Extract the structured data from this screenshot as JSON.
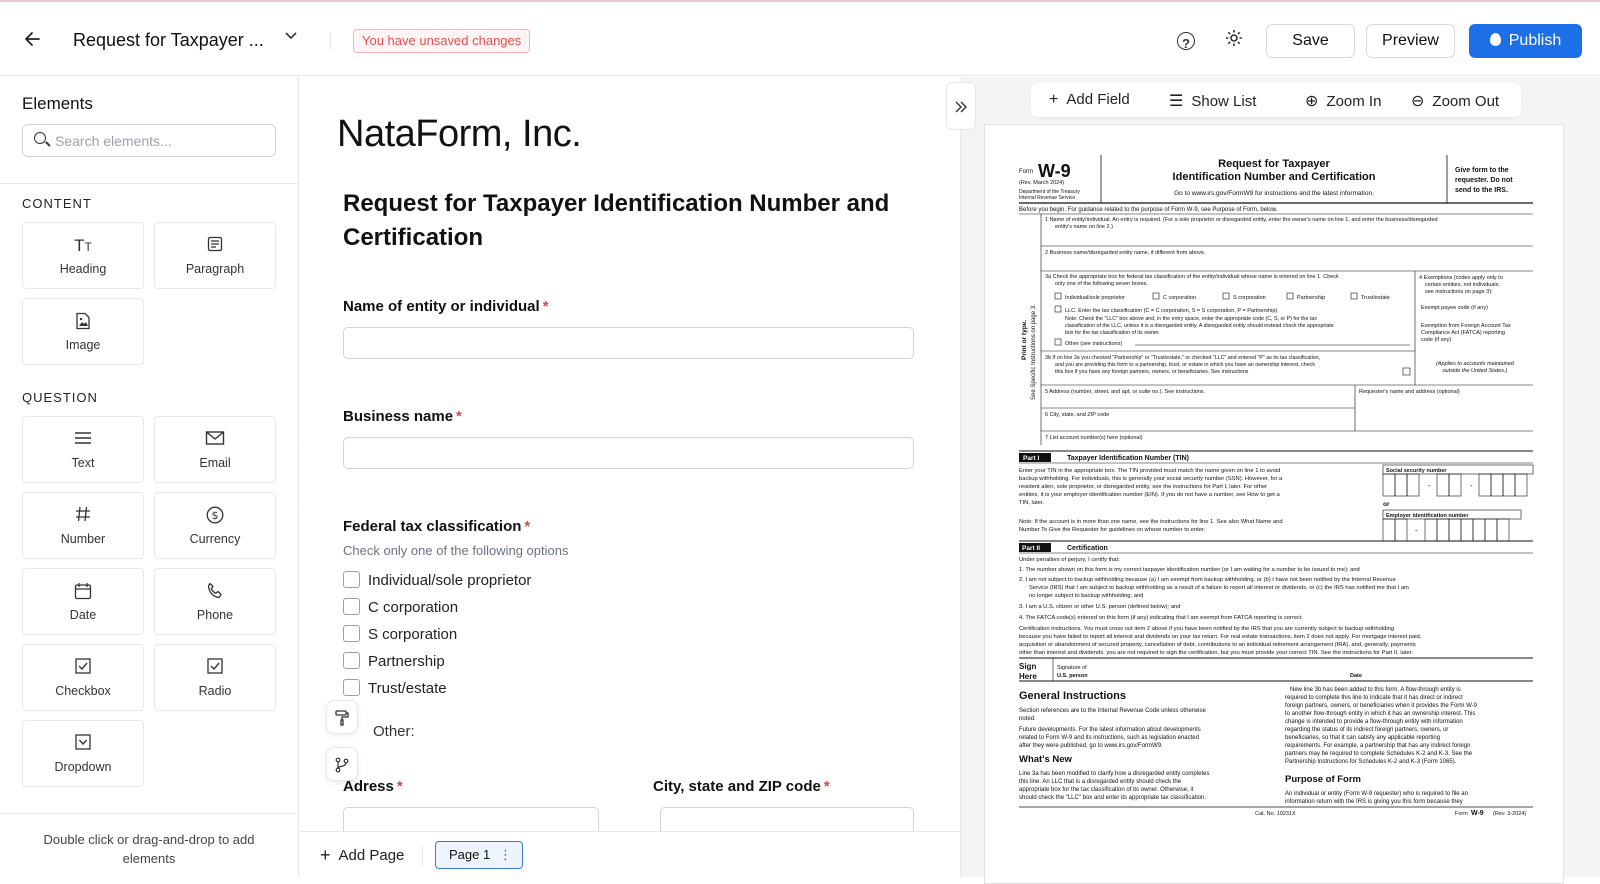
{
  "header": {
    "doc_title": "Request for Taxpayer ...",
    "unsaved": "You have unsaved changes",
    "help_glyph": "?",
    "save": "Save",
    "preview": "Preview",
    "publish": "Publish"
  },
  "elements_panel": {
    "title": "Elements",
    "search_placeholder": "Search elements...",
    "content_label": "CONTENT",
    "question_label": "QUESTION",
    "content": [
      {
        "label": "Heading",
        "icon": "heading-icon"
      },
      {
        "label": "Paragraph",
        "icon": "paragraph-icon"
      },
      {
        "label": "Image",
        "icon": "image-icon"
      }
    ],
    "questions": [
      {
        "label": "Text",
        "icon": "text-icon"
      },
      {
        "label": "Email",
        "icon": "email-icon"
      },
      {
        "label": "Number",
        "icon": "number-icon"
      },
      {
        "label": "Currency",
        "icon": "currency-icon"
      },
      {
        "label": "Date",
        "icon": "calendar-icon"
      },
      {
        "label": "Phone",
        "icon": "phone-icon"
      },
      {
        "label": "Checkbox",
        "icon": "checkbox-icon"
      },
      {
        "label": "Radio",
        "icon": "radio-icon"
      },
      {
        "label": "Dropdown",
        "icon": "dropdown-icon"
      }
    ],
    "footer_hint": "Double click or drag-and-drop to add elements"
  },
  "form": {
    "brand": "NataForm, Inc.",
    "title": "Request for Taxpayer Identification Number and Certification",
    "fields": {
      "entity_name": "Name of entity or individual",
      "business_name": "Business name",
      "tax_class": "Federal tax classification",
      "tax_class_help": "Check only one of the following options",
      "address": "Adress",
      "city_state_zip": "City, state and ZIP code"
    },
    "required_mark": "*",
    "options": [
      "Individual/sole proprietor",
      "C corporation",
      "S corporation",
      "Partnership",
      "Trust/estate"
    ],
    "other_label": "Other:"
  },
  "footer": {
    "add_page": "Add Page",
    "page_tab": "Page 1",
    "page_menu": "⋮"
  },
  "pdf_toolbar": {
    "add_field": "Add Field",
    "show_list": "Show List",
    "zoom_in": "Zoom In",
    "zoom_out": "Zoom Out"
  },
  "w9": {
    "form_label": "Form",
    "form_code": "W-9",
    "rev": "(Rev. March 2024)",
    "dept": "Department of the Treasury",
    "irs": "Internal Revenue Service",
    "title1": "Request for Taxpayer",
    "title2": "Identification Number and Certification",
    "goto": "Go to www.irs.gov/FormW9 for instructions and the latest information.",
    "give1": "Give form to the",
    "give2": "requester. Do not",
    "give3": "send to the IRS.",
    "before": "Before you begin. For guidance related to the purpose of Form W-9, see Purpose of Form, below.",
    "line1": "1   Name of entity/individual. An entry is required. (For a sole proprietor or disregarded entity, enter the owner's name on line 1, and enter the business/disregarded",
    "line1b": "entity's name on line 2.)",
    "line2": "2   Business name/disregarded entity name, if different from above.",
    "line3a": "3a  Check the appropriate box for federal tax classification of the entity/individual whose name is entered on line 1. Check",
    "line3a2": "only one of the following seven boxes.",
    "cb_items": [
      "Individual/sole proprietor",
      "C corporation",
      "S corporation",
      "Partnership",
      "Trust/estate"
    ],
    "llc": "LLC. Enter the tax classification (C = C corporation, S = S corporation, P = Partnership)",
    "note1": "Note: Check the \"LLC\" box above and, in the entry space, enter the appropriate code (C, S, or P) for the tax",
    "note2": "classification of the LLC, unless it is a disregarded entity. A disregarded entity should instead check the appropriate",
    "note3": "box for the tax classification of its owner.",
    "other": "Other (see instructions)",
    "line3b1": "3b  If on line 3a you checked \"Partnership\" or \"Trust/estate,\" or checked \"LLC\" and entered \"P\" as its tax classification,",
    "line3b2": "and you are providing this form to a partnership, trust, or estate in which you have an ownership interest, check",
    "line3b3": "this box if you have any foreign partners, owners, or beneficiaries. See instructions",
    "ex1": "4  Exemptions (codes apply only to",
    "ex2": "certain entities, not individuals;",
    "ex3": "see instructions on page 3):",
    "ex4": "Exempt payee code (if any)",
    "ex5": "Exemption from Foreign Account Tax",
    "ex6": "Compliance Act (FATCA) reporting",
    "ex7": "code (if any)",
    "ex8": "(Applies to accounts maintained",
    "ex9": "outside the United States.)",
    "side1": "Print or type.",
    "side2": "See Specific Instructions on page 3.",
    "line5": "5   Address (number, street, and apt. or suite no.). See instructions.",
    "requester": "Requester's name and address (optional)",
    "line6": "6   City, state, and ZIP code",
    "line7": "7   List account number(s) here (optional)",
    "part1": "Part I",
    "part1_title": "Taxpayer Identification Number (TIN)",
    "tin1": "Enter your TIN in the appropriate box. The TIN provided must match the name given on line 1 to avoid",
    "tin2": "backup withholding. For individuals, this is generally your social security number (SSN). However, for a",
    "tin3": "resident alien, sole proprietor, or disregarded entity, see the instructions for Part I, later. For other",
    "tin4": "entities, it is your employer identification number (EIN). If you do not have a number, see How to get a",
    "tin5": "TIN, later.",
    "ssn": "Social security number",
    "or": "or",
    "ein": "Employer identification number",
    "note_tin1": "Note: If the account is in more than one name, see the instructions for line 1. See also What Name and",
    "note_tin2": "Number To Give the Requester for guidelines on whose number to enter.",
    "part2": "Part II",
    "part2_title": "Certification",
    "cert0": "Under penalties of perjury, I certify that:",
    "cert1": "1. The number shown on this form is my correct taxpayer identification number (or I am waiting for a number to be issued to me); and",
    "cert2a": "2. I am not subject to backup withholding because (a) I am exempt from backup withholding, or (b) I have not been notified by the Internal Revenue",
    "cert2b": "Service (IRS) that I am subject to backup withholding as a result of a failure to report all interest or dividends, or (c) the IRS has notified me that I am",
    "cert2c": "no longer subject to backup withholding; and",
    "cert3": "3. I am a U.S. citizen or other U.S. person (defined below); and",
    "cert4": "4. The FATCA code(s) entered on this form (if any) indicating that I am exempt from FATCA reporting is correct.",
    "ci1": "Certification instructions. You must cross out item 2 above if you have been notified by the IRS that you are currently subject to backup withholding",
    "ci2": "because you have failed to report all interest and dividends on your tax return. For real estate transactions, item 2 does not apply. For mortgage interest paid,",
    "ci3": "acquisition or abandonment of secured property, cancellation of debt, contributions to an individual retirement arrangement (IRA), and, generally, payments",
    "ci4": "other than interest and dividends, you are not required to sign the certification, but you must provide your correct TIN. See the instructions for Part II, later.",
    "sign1": "Sign",
    "sign2": "Here",
    "sig1": "Signature of",
    "sig2": "U.S. person",
    "date": "Date",
    "gi": "General Instructions",
    "gi1": "Section references are to the Internal Revenue Code unless otherwise",
    "gi2": "noted.",
    "fd1": "Future developments. For the latest information about developments",
    "fd2": "related to Form W-9 and its instructions, such as legislation enacted",
    "fd3": "after they were published, go to www.irs.gov/FormW9.",
    "wn": "What's New",
    "wn1": "Line 3a has been modified to clarify how a disregarded entity completes",
    "wn2": "this line. An LLC that is a disregarded entity should check the",
    "wn3": "appropriate box for the tax classification of its owner. Otherwise, it",
    "wn4": "should check the \"LLC\" box and enter its appropriate tax classification.",
    "rc1": "New line 3b has been added to this form. A flow-through entity is",
    "rc2": "required to complete this line to indicate that it has direct or indirect",
    "rc3": "foreign partners, owners, or beneficiaries when it provides the Form W-9",
    "rc4": "to another flow-through entity in which it has an ownership interest. This",
    "rc5": "change is intended to provide a flow-through entity with information",
    "rc6": "regarding the status of its indirect foreign partners, owners, or",
    "rc7": "beneficiaries, so that it can satisfy any applicable reporting",
    "rc8": "requirements. For example, a partnership that has any indirect foreign",
    "rc9": "partners may be required to complete Schedules K-2 and K-3. See the",
    "rc10": "Partnership Instructions for Schedules K-2 and K-3 (Form 1065).",
    "pf": "Purpose of Form",
    "pf1": "An individual or entity (Form W-9 requester) who is required to file an",
    "pf2": "information return with the IRS is giving you this form because they",
    "cat": "Cat. No. 10231X",
    "foot_form": "Form",
    "foot_code": "W-9",
    "foot_rev": "(Rev. 3-2024)"
  }
}
